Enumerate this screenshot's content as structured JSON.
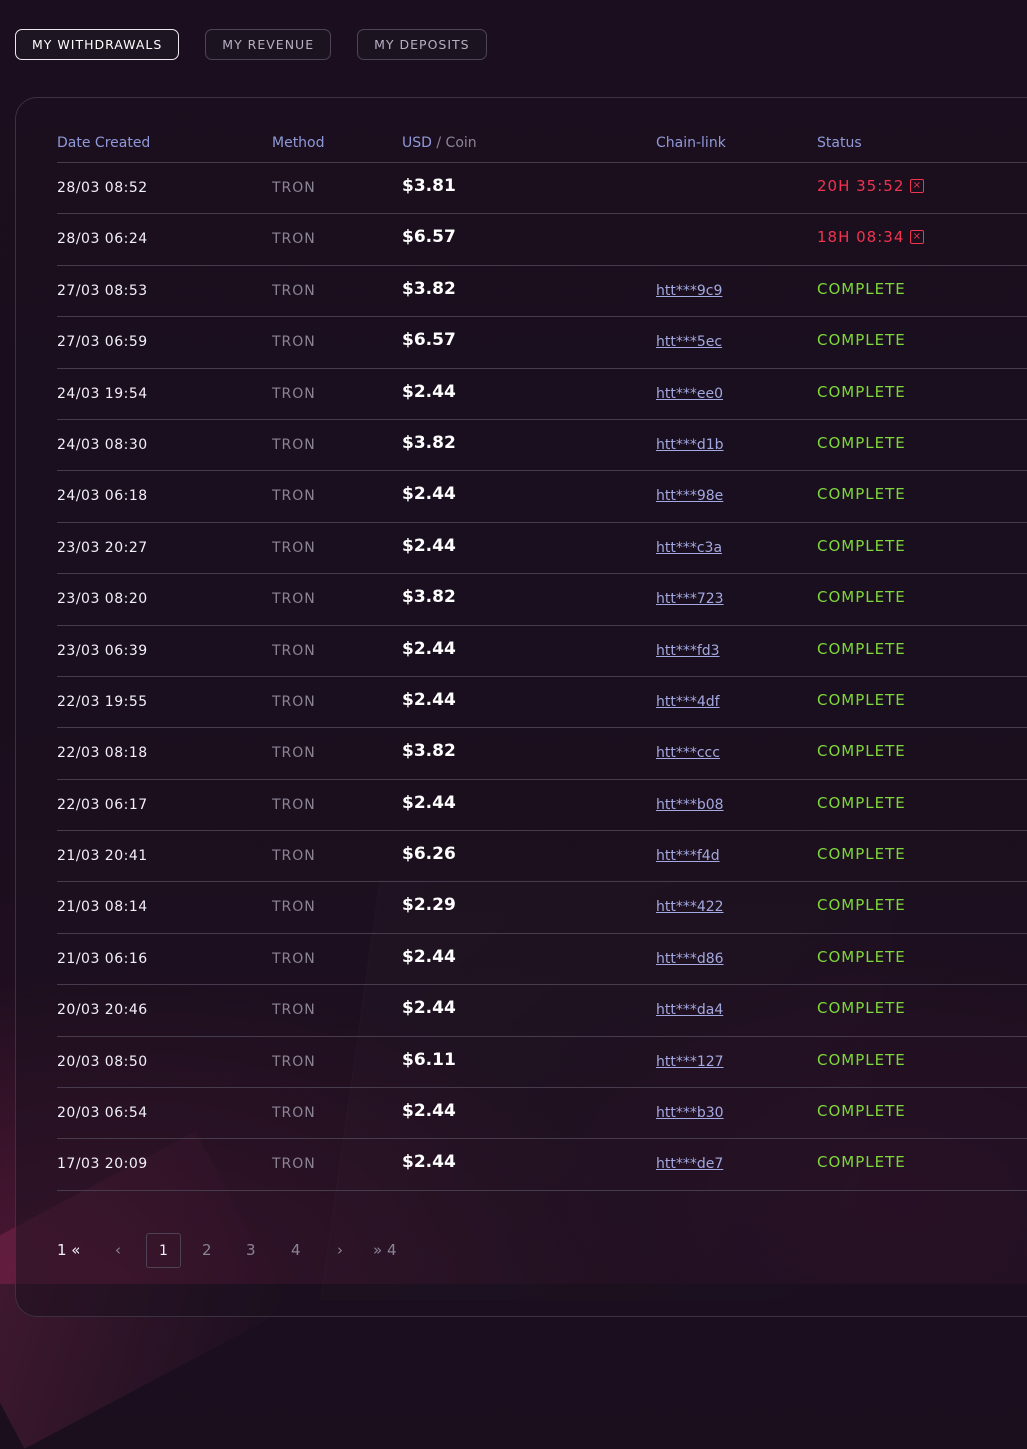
{
  "tabs": [
    {
      "label": "MY WITHDRAWALS",
      "active": true
    },
    {
      "label": "MY REVENUE",
      "active": false
    },
    {
      "label": "MY DEPOSITS",
      "active": false
    }
  ],
  "table": {
    "headers": {
      "date": "Date Created",
      "method": "Method",
      "usd": "USD",
      "separator": " / ",
      "coin": "Coin",
      "chain_link": "Chain-link",
      "status": "Status"
    },
    "rows": [
      {
        "date": "28/03 08:52",
        "method": "TRON",
        "usd": "$3.81",
        "link": "",
        "status": "20H 35:52",
        "status_type": "pending"
      },
      {
        "date": "28/03 06:24",
        "method": "TRON",
        "usd": "$6.57",
        "link": "",
        "status": "18H 08:34",
        "status_type": "pending"
      },
      {
        "date": "27/03 08:53",
        "method": "TRON",
        "usd": "$3.82",
        "link": "htt***9c9",
        "status": "COMPLETE",
        "status_type": "complete"
      },
      {
        "date": "27/03 06:59",
        "method": "TRON",
        "usd": "$6.57",
        "link": "htt***5ec",
        "status": "COMPLETE",
        "status_type": "complete"
      },
      {
        "date": "24/03 19:54",
        "method": "TRON",
        "usd": "$2.44",
        "link": "htt***ee0",
        "status": "COMPLETE",
        "status_type": "complete"
      },
      {
        "date": "24/03 08:30",
        "method": "TRON",
        "usd": "$3.82",
        "link": "htt***d1b",
        "status": "COMPLETE",
        "status_type": "complete"
      },
      {
        "date": "24/03 06:18",
        "method": "TRON",
        "usd": "$2.44",
        "link": "htt***98e",
        "status": "COMPLETE",
        "status_type": "complete"
      },
      {
        "date": "23/03 20:27",
        "method": "TRON",
        "usd": "$2.44",
        "link": "htt***c3a",
        "status": "COMPLETE",
        "status_type": "complete"
      },
      {
        "date": "23/03 08:20",
        "method": "TRON",
        "usd": "$3.82",
        "link": "htt***723",
        "status": "COMPLETE",
        "status_type": "complete"
      },
      {
        "date": "23/03 06:39",
        "method": "TRON",
        "usd": "$2.44",
        "link": "htt***fd3",
        "status": "COMPLETE",
        "status_type": "complete"
      },
      {
        "date": "22/03 19:55",
        "method": "TRON",
        "usd": "$2.44",
        "link": "htt***4df",
        "status": "COMPLETE",
        "status_type": "complete"
      },
      {
        "date": "22/03 08:18",
        "method": "TRON",
        "usd": "$3.82",
        "link": "htt***ccc",
        "status": "COMPLETE",
        "status_type": "complete"
      },
      {
        "date": "22/03 06:17",
        "method": "TRON",
        "usd": "$2.44",
        "link": "htt***b08",
        "status": "COMPLETE",
        "status_type": "complete"
      },
      {
        "date": "21/03 20:41",
        "method": "TRON",
        "usd": "$6.26",
        "link": "htt***f4d",
        "status": "COMPLETE",
        "status_type": "complete"
      },
      {
        "date": "21/03 08:14",
        "method": "TRON",
        "usd": "$2.29",
        "link": "htt***422",
        "status": "COMPLETE",
        "status_type": "complete"
      },
      {
        "date": "21/03 06:16",
        "method": "TRON",
        "usd": "$2.44",
        "link": "htt***d86",
        "status": "COMPLETE",
        "status_type": "complete"
      },
      {
        "date": "20/03 20:46",
        "method": "TRON",
        "usd": "$2.44",
        "link": "htt***da4",
        "status": "COMPLETE",
        "status_type": "complete"
      },
      {
        "date": "20/03 08:50",
        "method": "TRON",
        "usd": "$6.11",
        "link": "htt***127",
        "status": "COMPLETE",
        "status_type": "complete"
      },
      {
        "date": "20/03 06:54",
        "method": "TRON",
        "usd": "$2.44",
        "link": "htt***b30",
        "status": "COMPLETE",
        "status_type": "complete"
      },
      {
        "date": "17/03 20:09",
        "method": "TRON",
        "usd": "$2.44",
        "link": "htt***de7",
        "status": "COMPLETE",
        "status_type": "complete"
      }
    ]
  },
  "pagination": {
    "first_label": "1 «",
    "prev_icon": "‹",
    "pages": [
      "1",
      "2",
      "3",
      "4"
    ],
    "current_page": "1",
    "next_icon": "›",
    "last_label": "» 4"
  },
  "icons": {
    "cancel": "close-box-icon"
  },
  "colors": {
    "complete": "#7fd83b",
    "pending": "#f0334f",
    "header": "#8f99d8",
    "link": "#a4a8e0"
  }
}
